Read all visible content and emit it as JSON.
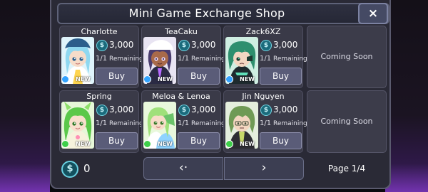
{
  "shop": {
    "title": "Mini Game Exchange Shop",
    "close_label": "×"
  },
  "items": [
    {
      "name": "Charlotte",
      "price": "3,000",
      "remaining_count": "1/1",
      "remaining_label": "Remaining",
      "buy_label": "Buy",
      "badge": "NEW",
      "currency_symbol": "$",
      "palette": {
        "bg": "#dff4fb",
        "hair": "#8fd8f0",
        "hat": "#2b5e8c",
        "skin": "#f6dcc9",
        "outfit": "#ffffff",
        "accent": "#ffd54f",
        "star": "#33a3ff"
      }
    },
    {
      "name": "TeaCaku",
      "price": "3,000",
      "remaining_count": "1/1",
      "remaining_label": "Remaining",
      "buy_label": "Buy",
      "badge": "NEW",
      "currency_symbol": "$",
      "palette": {
        "bg": "#e8e4f2",
        "hair": "#4a3d6e",
        "hat": "#ffffff",
        "skin": "#a86a4a",
        "outfit": "#2a2a44",
        "accent": "#b86bff",
        "star": "#33a3ff"
      }
    },
    {
      "name": "Zack6XZ",
      "price": "3,000",
      "remaining_count": "1/1",
      "remaining_label": "Remaining",
      "buy_label": "Buy",
      "badge": "NEW",
      "currency_symbol": "$",
      "palette": {
        "bg": "#cfeee2",
        "hair": "#2e8f6e",
        "hat": "#1e3a32",
        "skin": "#f4d7c2",
        "outfit": "#1e2a2e",
        "accent": "#5fe0b8",
        "star": "#33a3ff"
      }
    },
    {
      "name": "Spring",
      "price": "3,000",
      "remaining_count": "1/1",
      "remaining_label": "Remaining",
      "buy_label": "Buy",
      "badge": "NEW",
      "currency_symbol": "$",
      "palette": {
        "bg": "#e6f7d8",
        "hair": "#5bc84a",
        "hat": "#8ee06a",
        "skin": "#f8dfcd",
        "outfit": "#f6f2dc",
        "accent": "#ff8fb4",
        "star": "#3ecf4a"
      }
    },
    {
      "name": "Meloa & Lenoa",
      "price": "3,000",
      "remaining_count": "1/1",
      "remaining_label": "Remaining",
      "buy_label": "Buy",
      "badge": "NEW",
      "currency_symbol": "$",
      "palette": {
        "bg": "#e9f8dc",
        "hair": "#9fe07a",
        "hat": "#6bc36a",
        "skin": "#f7dcc8",
        "outfit": "#ffffff",
        "accent": "#8fd3ff",
        "star": "#3ecf4a"
      }
    },
    {
      "name": "Jin Nguyen",
      "price": "3,000",
      "remaining_count": "1/1",
      "remaining_label": "Remaining",
      "buy_label": "Buy",
      "badge": "NEW",
      "currency_symbol": "$",
      "palette": {
        "bg": "#e4eedd",
        "hair": "#6f9a55",
        "hat": "#3b4a34",
        "skin": "#f3d6c0",
        "outfit": "#2d2d33",
        "accent": "#c7d96a",
        "star": "#3ecf4a"
      }
    }
  ],
  "coming_soon": [
    "Coming Soon",
    "Coming Soon"
  ],
  "footer": {
    "currency_symbol": "$",
    "balance": "0",
    "prev_label": "‹·",
    "next_label": "›",
    "page_indicator": "Page 1/4"
  },
  "colors": {
    "panel": "#2a2a36",
    "card": "#3a3a48",
    "button": "#5a5c78",
    "coin_teal": "#74d4e2",
    "ambient_purple": "#a046f0"
  }
}
